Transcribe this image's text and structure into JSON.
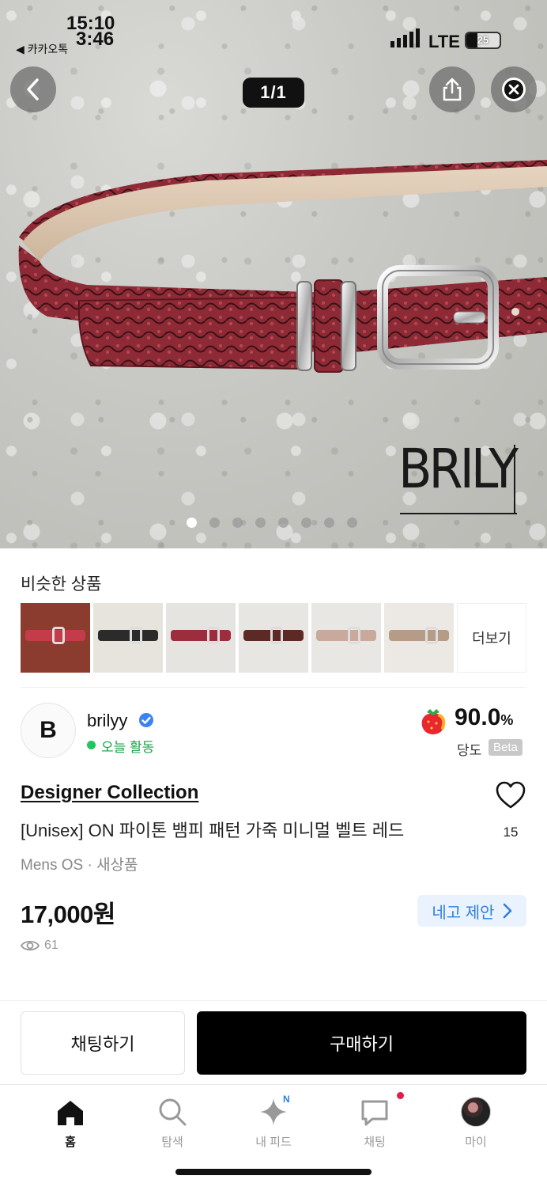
{
  "status_bar": {
    "time_top": "15:10",
    "time_bottom": "3:46",
    "back_app": "◀ 카카오톡",
    "network": "LTE",
    "battery": "25"
  },
  "hero": {
    "counter": "1/1",
    "brand_mark": "BRILY",
    "dot_count": 8,
    "active_dot": 0
  },
  "similar": {
    "title": "비슷한 상품",
    "more_label": "더보기",
    "thumbs": [
      {
        "band": "#c43c4a",
        "bg": "#8b3c2e"
      },
      {
        "band": "#2b2b2b",
        "bg": "#e7e4de"
      },
      {
        "band": "#9c2d3d",
        "bg": "#e6e4e0"
      },
      {
        "band": "#5b2a25",
        "bg": "#e8e6e2"
      },
      {
        "band": "#c9a99b",
        "bg": "#e9e7e3"
      },
      {
        "band": "#b69c86",
        "bg": "#ece9e4"
      }
    ]
  },
  "seller": {
    "logo_letter": "B",
    "name": "brilyy",
    "activity": "오늘 활동",
    "sweetness_value": "90.0",
    "sweetness_unit": "%",
    "sweetness_label": "당도",
    "beta": "Beta"
  },
  "product": {
    "collection": "Designer Collection",
    "title": "[Unisex] ON 파이톤 뱀피 패턴 가죽 미니멀 벨트 레드",
    "meta": "Mens OS · 새상품",
    "price": "17,000원",
    "negotiate": "네고 제안",
    "likes": "15",
    "views": "61"
  },
  "actions": {
    "chat": "채팅하기",
    "buy": "구매하기"
  },
  "tabbar": {
    "home": "홈",
    "search": "탐색",
    "feed": "내 피드",
    "feed_badge": "N",
    "chat": "채팅",
    "my": "마이"
  },
  "colors": {
    "accent_blue": "#2f7de1",
    "active_green": "#16a34a",
    "buy_black": "#000000",
    "belt_red": "#8e2a35"
  }
}
